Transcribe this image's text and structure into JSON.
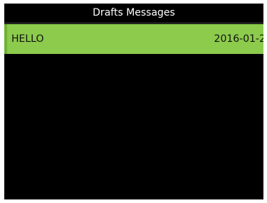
{
  "window": {
    "title": "Drafts Messages"
  },
  "messages": [
    {
      "text": "HELLO",
      "date": "2016-01-2",
      "selected": true
    }
  ],
  "colors": {
    "background": "#000000",
    "title_text": "#ffffff",
    "selected_row": "#8ccb4c",
    "selected_row_accent": "#6eb234",
    "row_text": "#111111"
  }
}
